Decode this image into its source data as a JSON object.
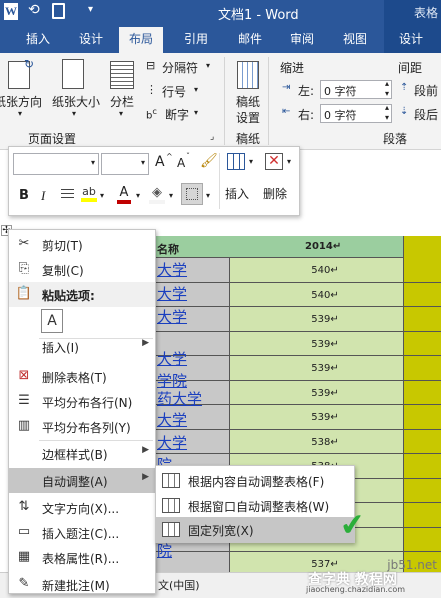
{
  "titlebar": {
    "doc_title": "文档1 - Word",
    "context_title": "表格"
  },
  "tabs": [
    "插入",
    "设计",
    "布局",
    "引用",
    "邮件",
    "审阅",
    "视图",
    "设计"
  ],
  "active_tab": "布局",
  "ribbon": {
    "page_setup": {
      "text_direction": "纸张方向",
      "paper_size": "纸张大小",
      "columns": "分栏",
      "breaks": "分隔符",
      "line_numbers": "行号",
      "hyphenation": "断字",
      "group_label": "页面设置"
    },
    "draft": {
      "label_line1": "稿纸",
      "label_line2": "设置",
      "group_label": "稿纸"
    },
    "indent": {
      "title": "缩进",
      "left_label": "左:",
      "left_value": "0 字符",
      "right_label": "右:",
      "right_value": "0 字符"
    },
    "spacing": {
      "title": "间距",
      "before_label": "段前",
      "after_label": "段后"
    },
    "paragraph_group_label": "段落"
  },
  "mini_toolbar": {
    "font_name": "",
    "font_size": "",
    "bold": "B",
    "italic": "I",
    "grow_font": "A",
    "shrink_font": "A",
    "font_color": "A",
    "insert_label": "插入",
    "delete_label": "删除"
  },
  "table": {
    "header_name": "名称",
    "header_2014": "2014",
    "values_2014": [
      "540",
      "540",
      "539",
      "539",
      "539",
      "539",
      "539",
      "538",
      "538",
      "538",
      "538",
      "537",
      "537"
    ],
    "visible_names": [
      "大学",
      "大学",
      "大学",
      "大学",
      "学院",
      "药大学",
      "大学",
      "大学",
      "院"
    ]
  },
  "context_menu": {
    "items": [
      {
        "label": "剪切(T)",
        "icon": "scissors-icon"
      },
      {
        "label": "复制(C)",
        "icon": "copy-icon"
      },
      {
        "label": "粘贴选项:",
        "icon": "paste-icon"
      },
      {
        "label": "",
        "icon": "paste-text-only-icon"
      },
      {
        "label": "插入(I)",
        "icon": "",
        "submenu": true
      },
      {
        "label": "删除表格(T)",
        "icon": "delete-table-icon"
      },
      {
        "label": "平均分布各行(N)",
        "icon": "distribute-rows-icon"
      },
      {
        "label": "平均分布各列(Y)",
        "icon": "distribute-columns-icon"
      },
      {
        "label": "边框样式(B)",
        "icon": "",
        "submenu": true
      },
      {
        "label": "自动调整(A)",
        "icon": "",
        "submenu": true,
        "highlighted": true
      },
      {
        "label": "文字方向(X)...",
        "icon": "text-direction-icon"
      },
      {
        "label": "插入题注(C)...",
        "icon": "insert-caption-icon"
      },
      {
        "label": "表格属性(R)...",
        "icon": "table-properties-icon"
      },
      {
        "label": "新建批注(M)",
        "icon": "new-comment-icon"
      }
    ]
  },
  "submenu": {
    "items": [
      {
        "label": "根据内容自动调整表格(F)",
        "icon": "autofit-contents-icon"
      },
      {
        "label": "根据窗口自动调整表格(W)",
        "icon": "autofit-window-icon"
      },
      {
        "label": "固定列宽(X)",
        "icon": "fixed-column-width-icon",
        "highlighted": true
      }
    ]
  },
  "statusbar": {
    "language": "文(中国)"
  },
  "watermark": {
    "text": "查字典 教程网",
    "url": "jb51.net",
    "sub": "jiaocheng.chazidian.com"
  },
  "colors": {
    "word_blue": "#2b579a",
    "header_green": "#9bce9f",
    "cell_green": "#d1e4ae",
    "yellow_col": "#c8c800",
    "gray_col": "#c8c8c8",
    "check_green": "#2bae3a"
  }
}
